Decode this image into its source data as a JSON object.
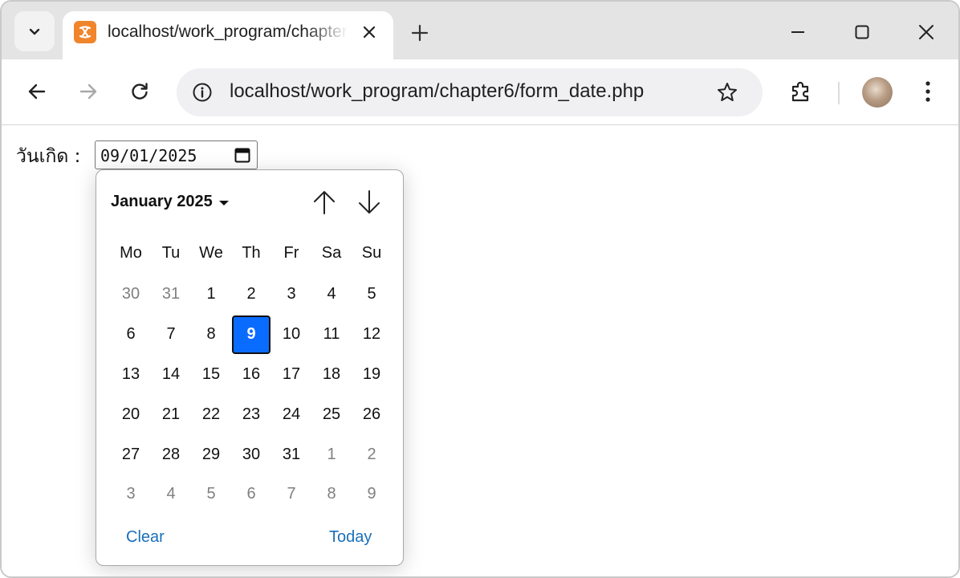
{
  "browser": {
    "tab": {
      "title": "localhost/work_program/chapter6/form_date.php"
    },
    "url": "localhost/work_program/chapter6/form_date.php",
    "icons": {
      "tab_search": "chevron-down-icon",
      "favicon": "xampp-icon",
      "tab_close": "close-icon",
      "new_tab": "plus-icon",
      "minimize": "minimize-icon",
      "maximize": "maximize-icon",
      "close_window": "close-icon",
      "back": "arrow-left-icon",
      "forward": "arrow-right-icon",
      "reload": "reload-icon",
      "site_info": "info-icon",
      "bookmark": "star-icon",
      "extensions": "puzzle-icon",
      "menu": "kebab-menu-icon"
    }
  },
  "form": {
    "label": "วันเกิด :",
    "date_value": "09/01/2025"
  },
  "datepicker": {
    "month_label": "January 2025",
    "weekdays": [
      "Mo",
      "Tu",
      "We",
      "Th",
      "Fr",
      "Sa",
      "Su"
    ],
    "weeks": [
      [
        {
          "d": "30",
          "m": true
        },
        {
          "d": "31",
          "m": true
        },
        {
          "d": "1"
        },
        {
          "d": "2"
        },
        {
          "d": "3"
        },
        {
          "d": "4"
        },
        {
          "d": "5"
        }
      ],
      [
        {
          "d": "6"
        },
        {
          "d": "7"
        },
        {
          "d": "8"
        },
        {
          "d": "9",
          "sel": true
        },
        {
          "d": "10"
        },
        {
          "d": "11"
        },
        {
          "d": "12"
        }
      ],
      [
        {
          "d": "13"
        },
        {
          "d": "14"
        },
        {
          "d": "15"
        },
        {
          "d": "16"
        },
        {
          "d": "17"
        },
        {
          "d": "18"
        },
        {
          "d": "19"
        }
      ],
      [
        {
          "d": "20"
        },
        {
          "d": "21"
        },
        {
          "d": "22"
        },
        {
          "d": "23"
        },
        {
          "d": "24"
        },
        {
          "d": "25"
        },
        {
          "d": "26"
        }
      ],
      [
        {
          "d": "27"
        },
        {
          "d": "28"
        },
        {
          "d": "29"
        },
        {
          "d": "30"
        },
        {
          "d": "31"
        },
        {
          "d": "1",
          "m": true
        },
        {
          "d": "2",
          "m": true
        }
      ],
      [
        {
          "d": "3",
          "m": true
        },
        {
          "d": "4",
          "m": true
        },
        {
          "d": "5",
          "m": true
        },
        {
          "d": "6",
          "m": true
        },
        {
          "d": "7",
          "m": true
        },
        {
          "d": "8",
          "m": true
        },
        {
          "d": "9",
          "m": true
        }
      ]
    ],
    "selected_date": "9",
    "clear_label": "Clear",
    "today_label": "Today",
    "colors": {
      "selected_bg": "#0a6cff",
      "link": "#1a6fba",
      "muted": "#808080"
    }
  }
}
